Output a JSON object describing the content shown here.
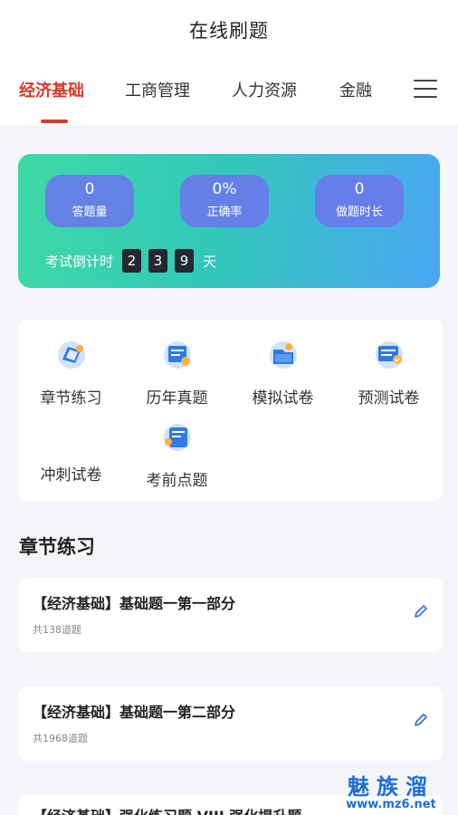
{
  "header": {
    "title": "在线刷题"
  },
  "tabs": [
    {
      "label": "经济基础",
      "active": true
    },
    {
      "label": "工商管理"
    },
    {
      "label": "人力资源"
    },
    {
      "label": "金融"
    }
  ],
  "stats": [
    {
      "value": "0",
      "label": "答题量"
    },
    {
      "value": "0%",
      "label": "正确率"
    },
    {
      "value": "0",
      "label": "做题时长"
    }
  ],
  "countdown": {
    "label": "考试倒计时",
    "digits": [
      "2",
      "3",
      "9"
    ],
    "unit": "天"
  },
  "functions": [
    {
      "label": "章节练习",
      "icon": "chapter-practice-icon"
    },
    {
      "label": "历年真题",
      "icon": "past-exams-icon"
    },
    {
      "label": "模拟试卷",
      "icon": "mock-paper-icon"
    },
    {
      "label": "预测试卷",
      "icon": "prediction-paper-icon"
    },
    {
      "label": "冲刺试卷",
      "icon": "sprint-paper-icon"
    },
    {
      "label": "考前点题",
      "icon": "pre-exam-tips-icon"
    }
  ],
  "section": {
    "title": "章节练习"
  },
  "items": [
    {
      "title": "【经济基础】基础题一第一部分",
      "count": "共138道题"
    },
    {
      "title": "【经济基础】基础题一第二部分",
      "count": "共1968道题"
    }
  ],
  "partial_item": {
    "title": "【经济基础】强化练习题 VIII 强化提升题"
  },
  "watermark": {
    "line1": "魅族溜",
    "line2": "www.mz6.net"
  },
  "colors": {
    "accent": "#d83a2c",
    "stat_bg": "#6879ea",
    "gradient_start": "#3fd9a6",
    "gradient_end": "#4aa6f4"
  }
}
